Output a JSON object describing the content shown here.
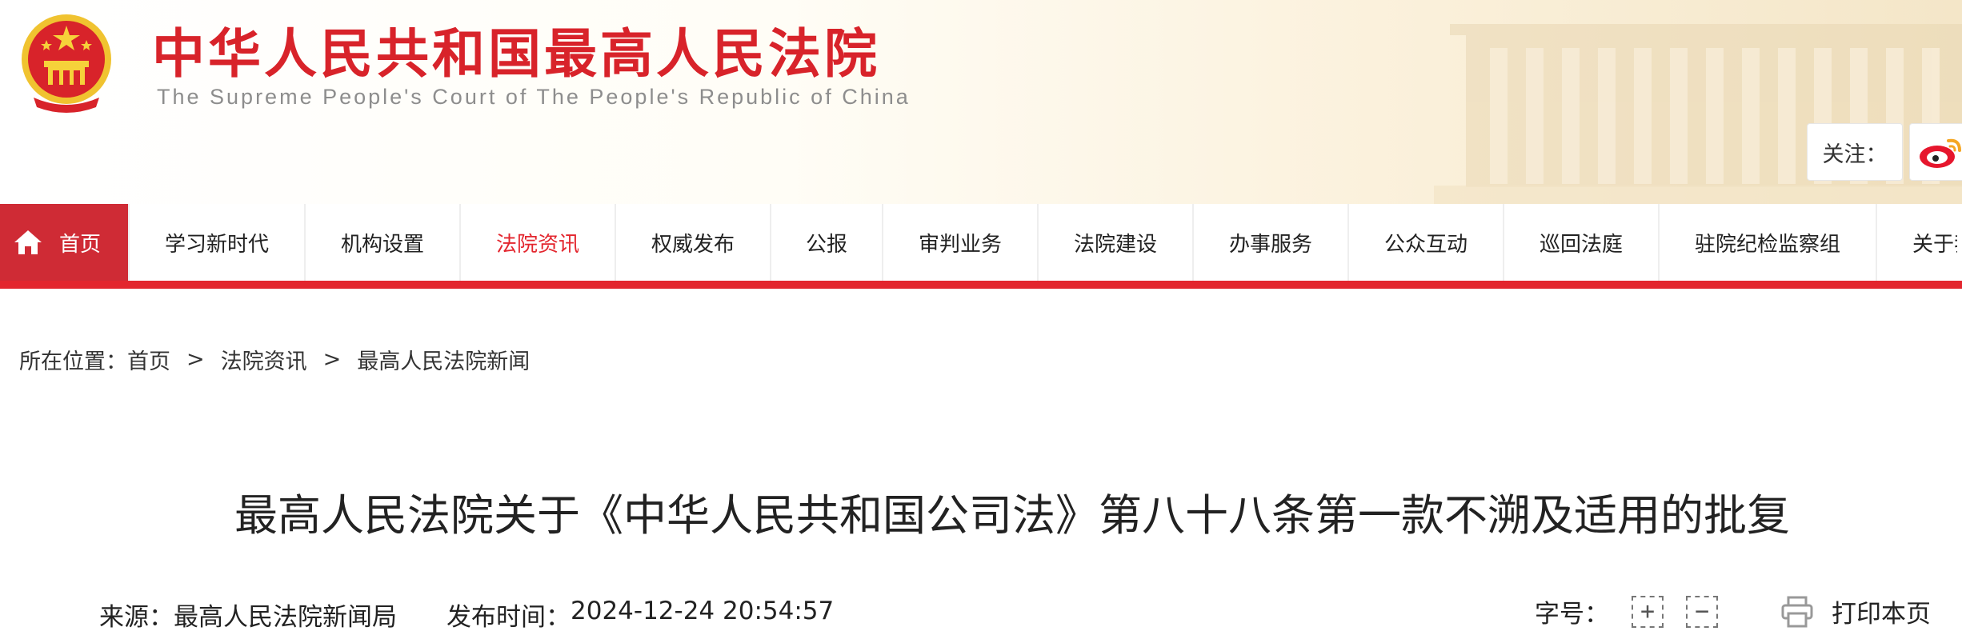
{
  "header": {
    "title": "中华人民共和国最高人民法院",
    "subtitle": "The Supreme People's Court of The People's Republic of China",
    "follow_label": "关注：",
    "brand_color": "#d8232a"
  },
  "nav": {
    "items": [
      {
        "label": "首页",
        "icon": "home-icon"
      },
      {
        "label": "学习新时代"
      },
      {
        "label": "机构设置"
      },
      {
        "label": "法院资讯"
      },
      {
        "label": "权威发布"
      },
      {
        "label": "公报"
      },
      {
        "label": "审判业务"
      },
      {
        "label": "法院建设"
      },
      {
        "label": "办事服务"
      },
      {
        "label": "公众互动"
      },
      {
        "label": "巡回法庭"
      },
      {
        "label": "驻院纪检监察组"
      },
      {
        "label": "关于我们"
      }
    ],
    "active_index": 3,
    "accent_color": "#e3262e"
  },
  "breadcrumb": {
    "prefix": "所在位置：",
    "items": [
      "首页",
      "法院资讯",
      "最高人民法院新闻"
    ],
    "separator": ">"
  },
  "article": {
    "title": "最高人民法院关于《中华人民共和国公司法》第八十八条第一款不溯及适用的批复",
    "source_label": "来源：",
    "source": "最高人民法院新闻局",
    "time_label": "发布时间：",
    "time": "2024-12-24 20:54:57",
    "font_size_label": "字号：",
    "increase_symbol": "+",
    "decrease_symbol": "−",
    "print_label": "打印本页"
  }
}
